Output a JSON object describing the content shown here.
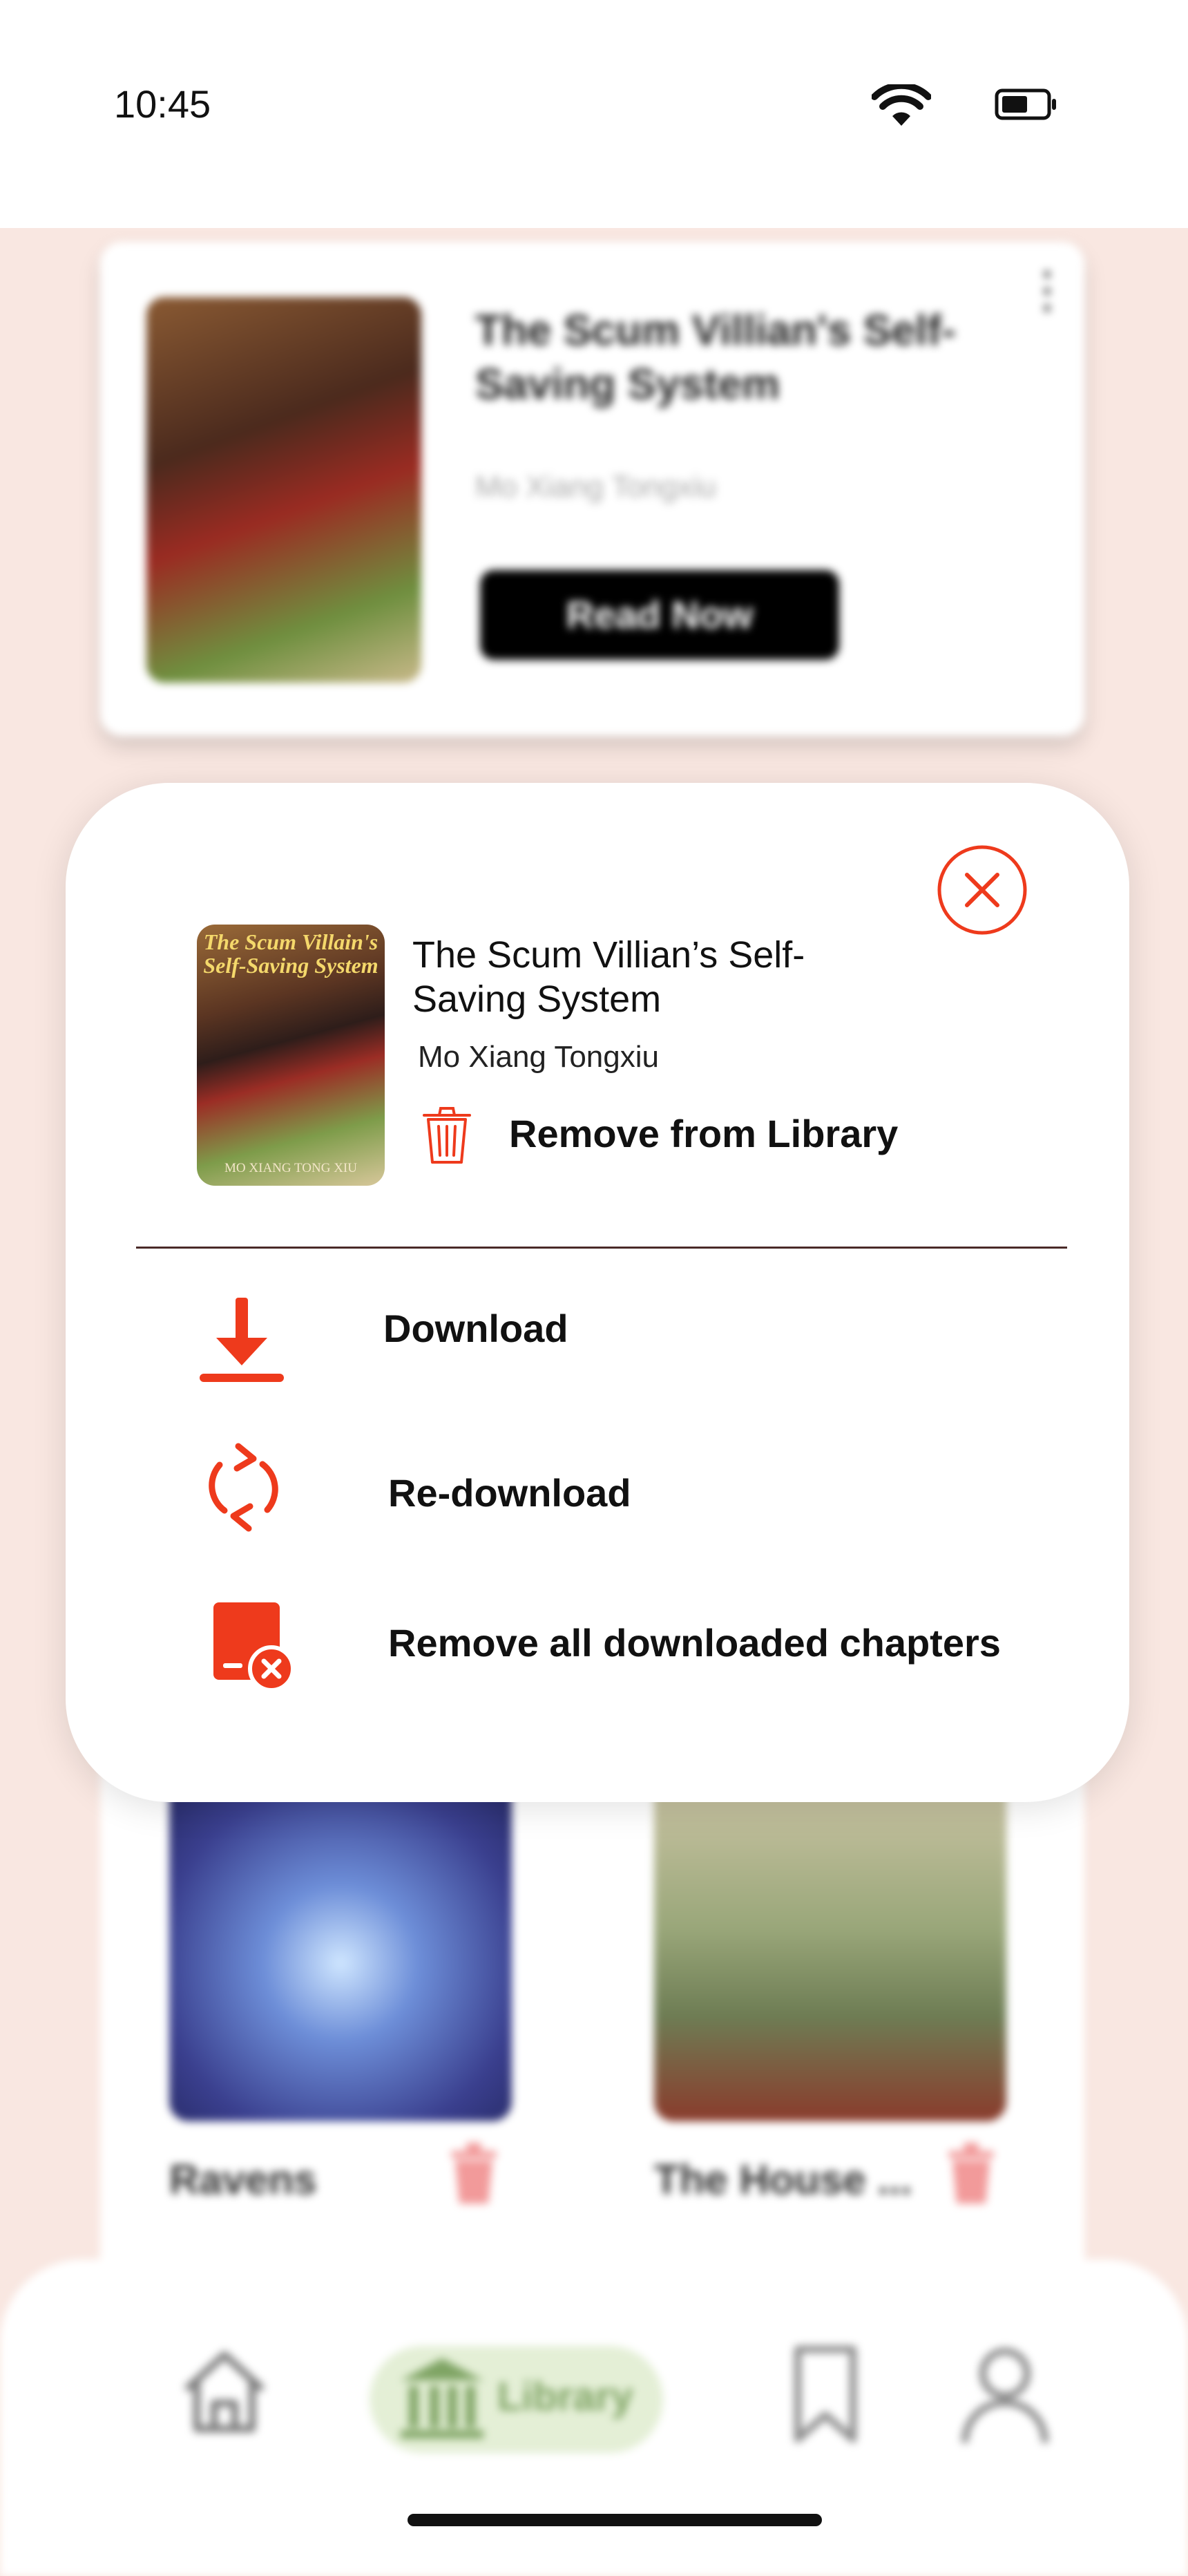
{
  "status_bar": {
    "time": "10:45",
    "icons": [
      "wifi-icon",
      "battery-icon"
    ]
  },
  "background": {
    "featured": {
      "title": "The Scum Villian's Self-Saving System",
      "author": "Mo Xiang Tongxiu",
      "read_button": "Read Now",
      "menu_icon": "kebab-icon"
    },
    "grid_items": [
      {
        "label": "Ravens"
      },
      {
        "label": "The House ..."
      }
    ],
    "bottom_nav": {
      "items": [
        "home-icon",
        "library-icon",
        "bookmark-icon",
        "profile-icon"
      ],
      "active_label": "Library",
      "active_bg_color": "#e4efd6",
      "active_fg_color": "#7fa464"
    }
  },
  "sheet": {
    "book": {
      "cover_title": "The Scum Villain's Self-Saving System",
      "cover_author": "MO XIANG TONG XIU",
      "title": "The Scum Villian’s Self-Saving System",
      "author": "Mo Xiang Tongxiu"
    },
    "remove_from_library": "Remove from Library",
    "actions": {
      "download": "Download",
      "redownload": "Re-download",
      "remove_all": "Remove all downloaded chapters"
    },
    "accent_color": "#ee3a1c",
    "close_icon": "close-circle-icon"
  }
}
